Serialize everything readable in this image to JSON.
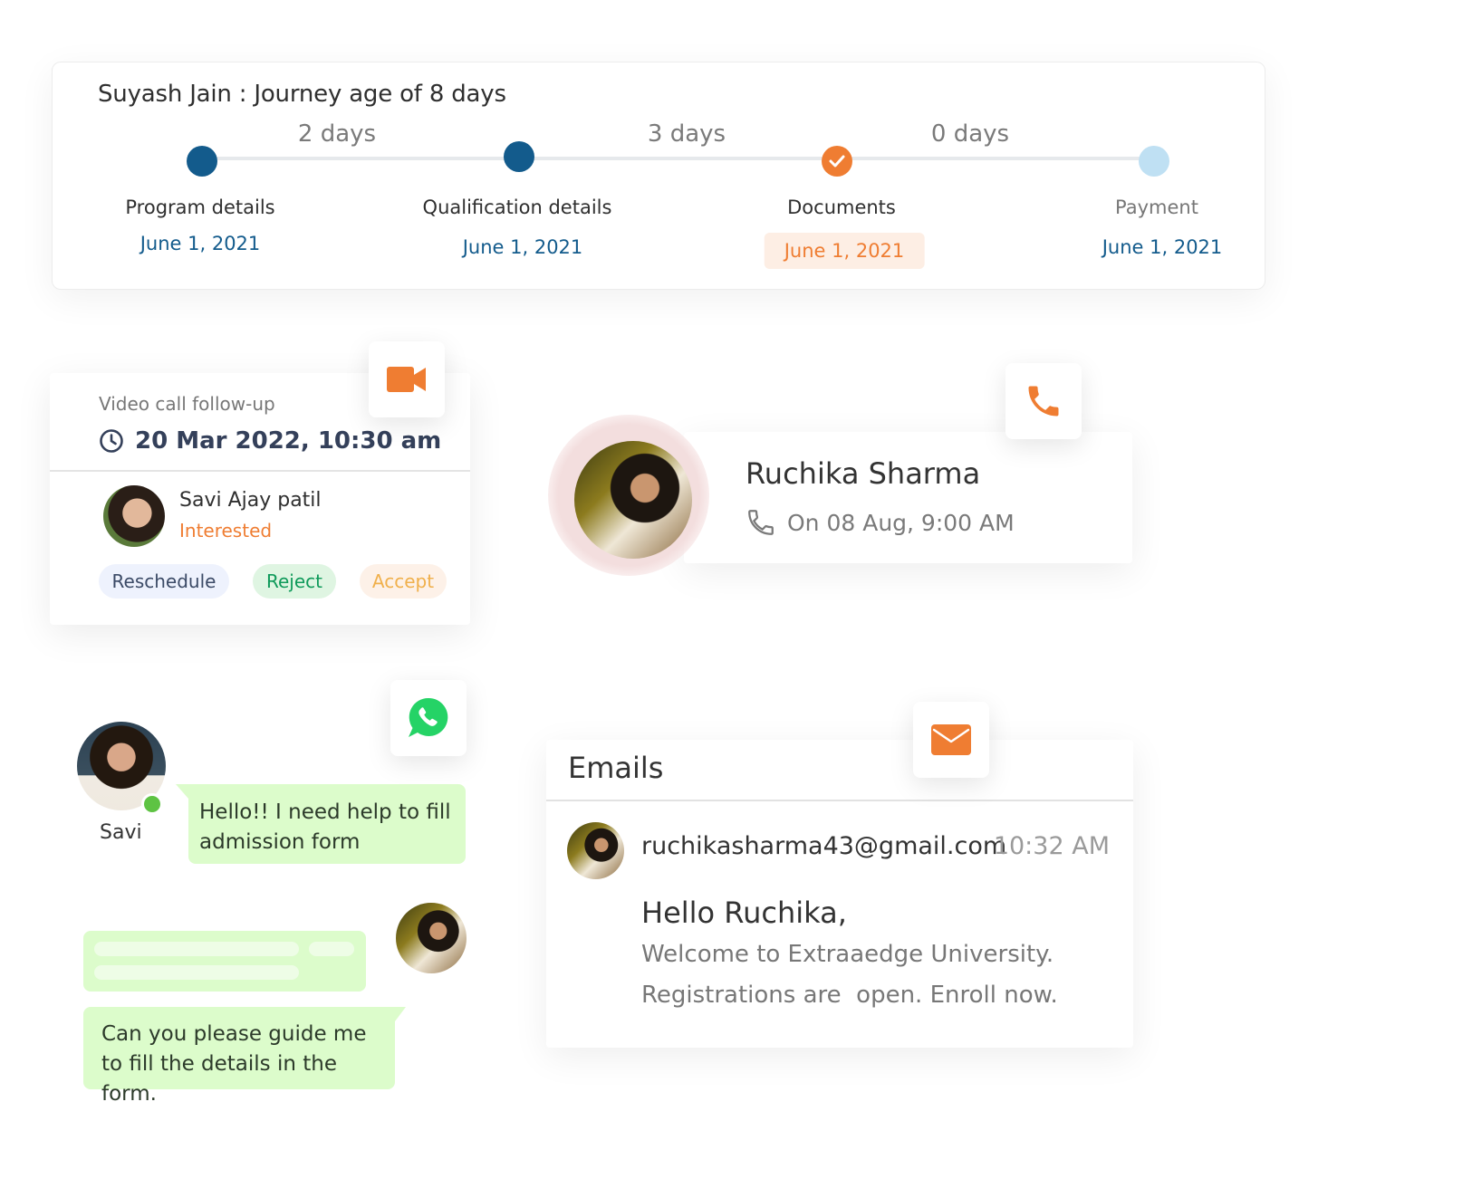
{
  "journey": {
    "title": "Suyash Jain : Journey age of 8 days",
    "stages": [
      {
        "label": "Program details",
        "date": "June 1, 2021",
        "status": "done"
      },
      {
        "label": "Qualification details",
        "date": "June 1, 2021",
        "status": "done"
      },
      {
        "label": "Documents",
        "date": "June 1, 2021",
        "status": "current"
      },
      {
        "label": "Payment",
        "date": "June 1, 2021",
        "status": "pending"
      }
    ],
    "gaps": [
      "2 days",
      "3 days",
      "0 days"
    ]
  },
  "video_call": {
    "icon": "video-camera-icon",
    "label": "Video call follow-up",
    "clock_icon": "clock-icon",
    "datetime": "20 Mar 2022, 10:30 am",
    "contact_name": "Savi Ajay patil",
    "contact_status": "Interested",
    "actions": {
      "reschedule": "Reschedule",
      "reject": "Reject",
      "accept": "Accept"
    }
  },
  "call": {
    "icon": "phone-icon",
    "name": "Ruchika Sharma",
    "when": "On 08 Aug, 9:00 AM"
  },
  "chat": {
    "icon": "whatsapp-icon",
    "sender_name": "Savi",
    "messages": [
      {
        "from": "Savi",
        "text": "Hello!! I need help to fill admission form"
      },
      {
        "from": "agent",
        "text": ""
      },
      {
        "from": "Savi",
        "text": "Can you please guide me to fill the details in the form."
      }
    ]
  },
  "email": {
    "icon": "mail-icon",
    "title": "Emails",
    "from": "ruchikasharma43@gmail.com",
    "time": "10:32 AM",
    "greeting": "Hello Ruchika,",
    "lines": [
      "Welcome to Extraaedge University.",
      "Registrations are  open. Enroll now."
    ]
  },
  "colors": {
    "brand_orange": "#ef7d32",
    "brand_blue": "#135b8c",
    "pending_blue": "#bfe0f3",
    "chat_green": "#dcfccb",
    "whatsapp_green": "#25d366"
  }
}
